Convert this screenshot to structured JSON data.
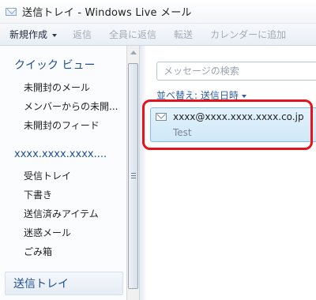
{
  "window": {
    "title": "送信トレイ - Windows Live メール",
    "icon": "mail-envelope-icon"
  },
  "toolbar": {
    "new_label": "新規作成",
    "reply_label": "返信",
    "reply_all_label": "全員に返信",
    "forward_label": "転送",
    "calendar_label": "カレンダーに追加"
  },
  "sidebar": {
    "quick_views_header": "クイック ビュー",
    "quick_views": [
      {
        "label": "未開封のメール"
      },
      {
        "label": "メンバーからの未開..."
      },
      {
        "label": "未開封のフィード"
      }
    ],
    "account_header": "xxxx.xxxx.xxxx....",
    "folders": [
      {
        "label": "受信トレイ"
      },
      {
        "label": "下書き"
      },
      {
        "label": "送信済みアイテム"
      },
      {
        "label": "迷惑メール"
      },
      {
        "label": "ごみ箱"
      }
    ],
    "selected_folder_bar": "送信トレイ"
  },
  "main": {
    "search_placeholder": "メッセージの検索",
    "sort_label": "並べ替え: 送信日時",
    "messages": [
      {
        "from": "xxxx@xxxx.xxxx.xxxx.co.jp",
        "subject": "Test"
      }
    ]
  },
  "colors": {
    "accent": "#1e4f94",
    "selection_bg": "#d8edfa",
    "selection_border": "#84c0e8",
    "annotation_red": "#e3141b"
  }
}
